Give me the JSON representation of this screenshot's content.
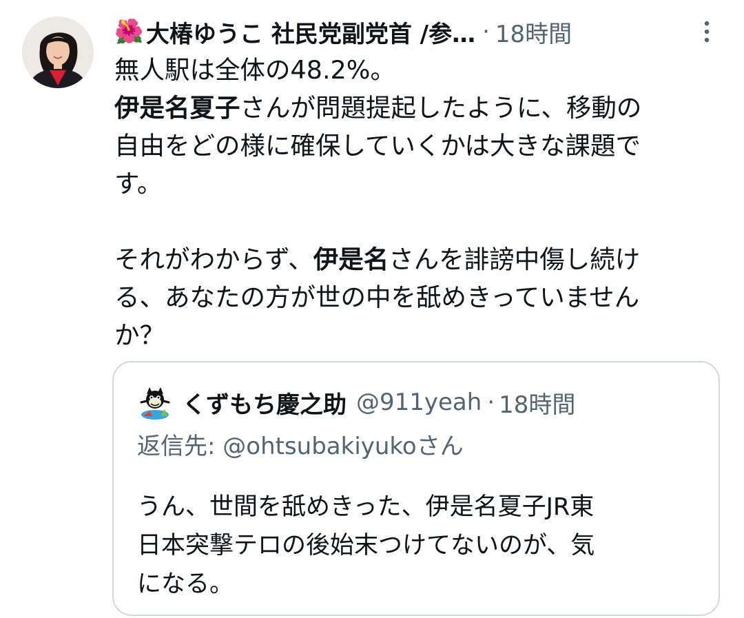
{
  "tweet": {
    "author_emoji": "🌺",
    "author_display": "大椿ゆうこ 社民党副党首 /参…",
    "separator": "·",
    "time": "18時間",
    "more_icon": "vertical-ellipsis-icon",
    "body": {
      "line1": "無人駅は全体の48.2%。",
      "p2_bold": "伊是名夏子",
      "p2_rest_line1": "さんが問題提起したように、移動の",
      "p2_line2": "自由をどの様に確保していくかは大きな課題で",
      "p2_line3": "す。",
      "p3_line1_pre": "それがわからず、",
      "p3_bold": "伊是名",
      "p3_line1_post": "さんを誹謗中傷し続け",
      "p3_line2": "る、あなたの方が世の中を舐めきっていません",
      "p3_line3": "か？"
    }
  },
  "quote": {
    "name": "くずもち慶之助",
    "handle": "@911yeah",
    "separator": "·",
    "time": "18時間",
    "reply_to": "返信先: @ohtsubakiyukoさん",
    "body": {
      "line1": "うん、世間を舐めきった、伊是名夏子JR東",
      "line2": "日本突撃テロの後始末つけてないのが、気",
      "line3": "になる。"
    }
  },
  "colors": {
    "text": "#0f1419",
    "secondary": "#536471",
    "border": "#cfd9de"
  }
}
